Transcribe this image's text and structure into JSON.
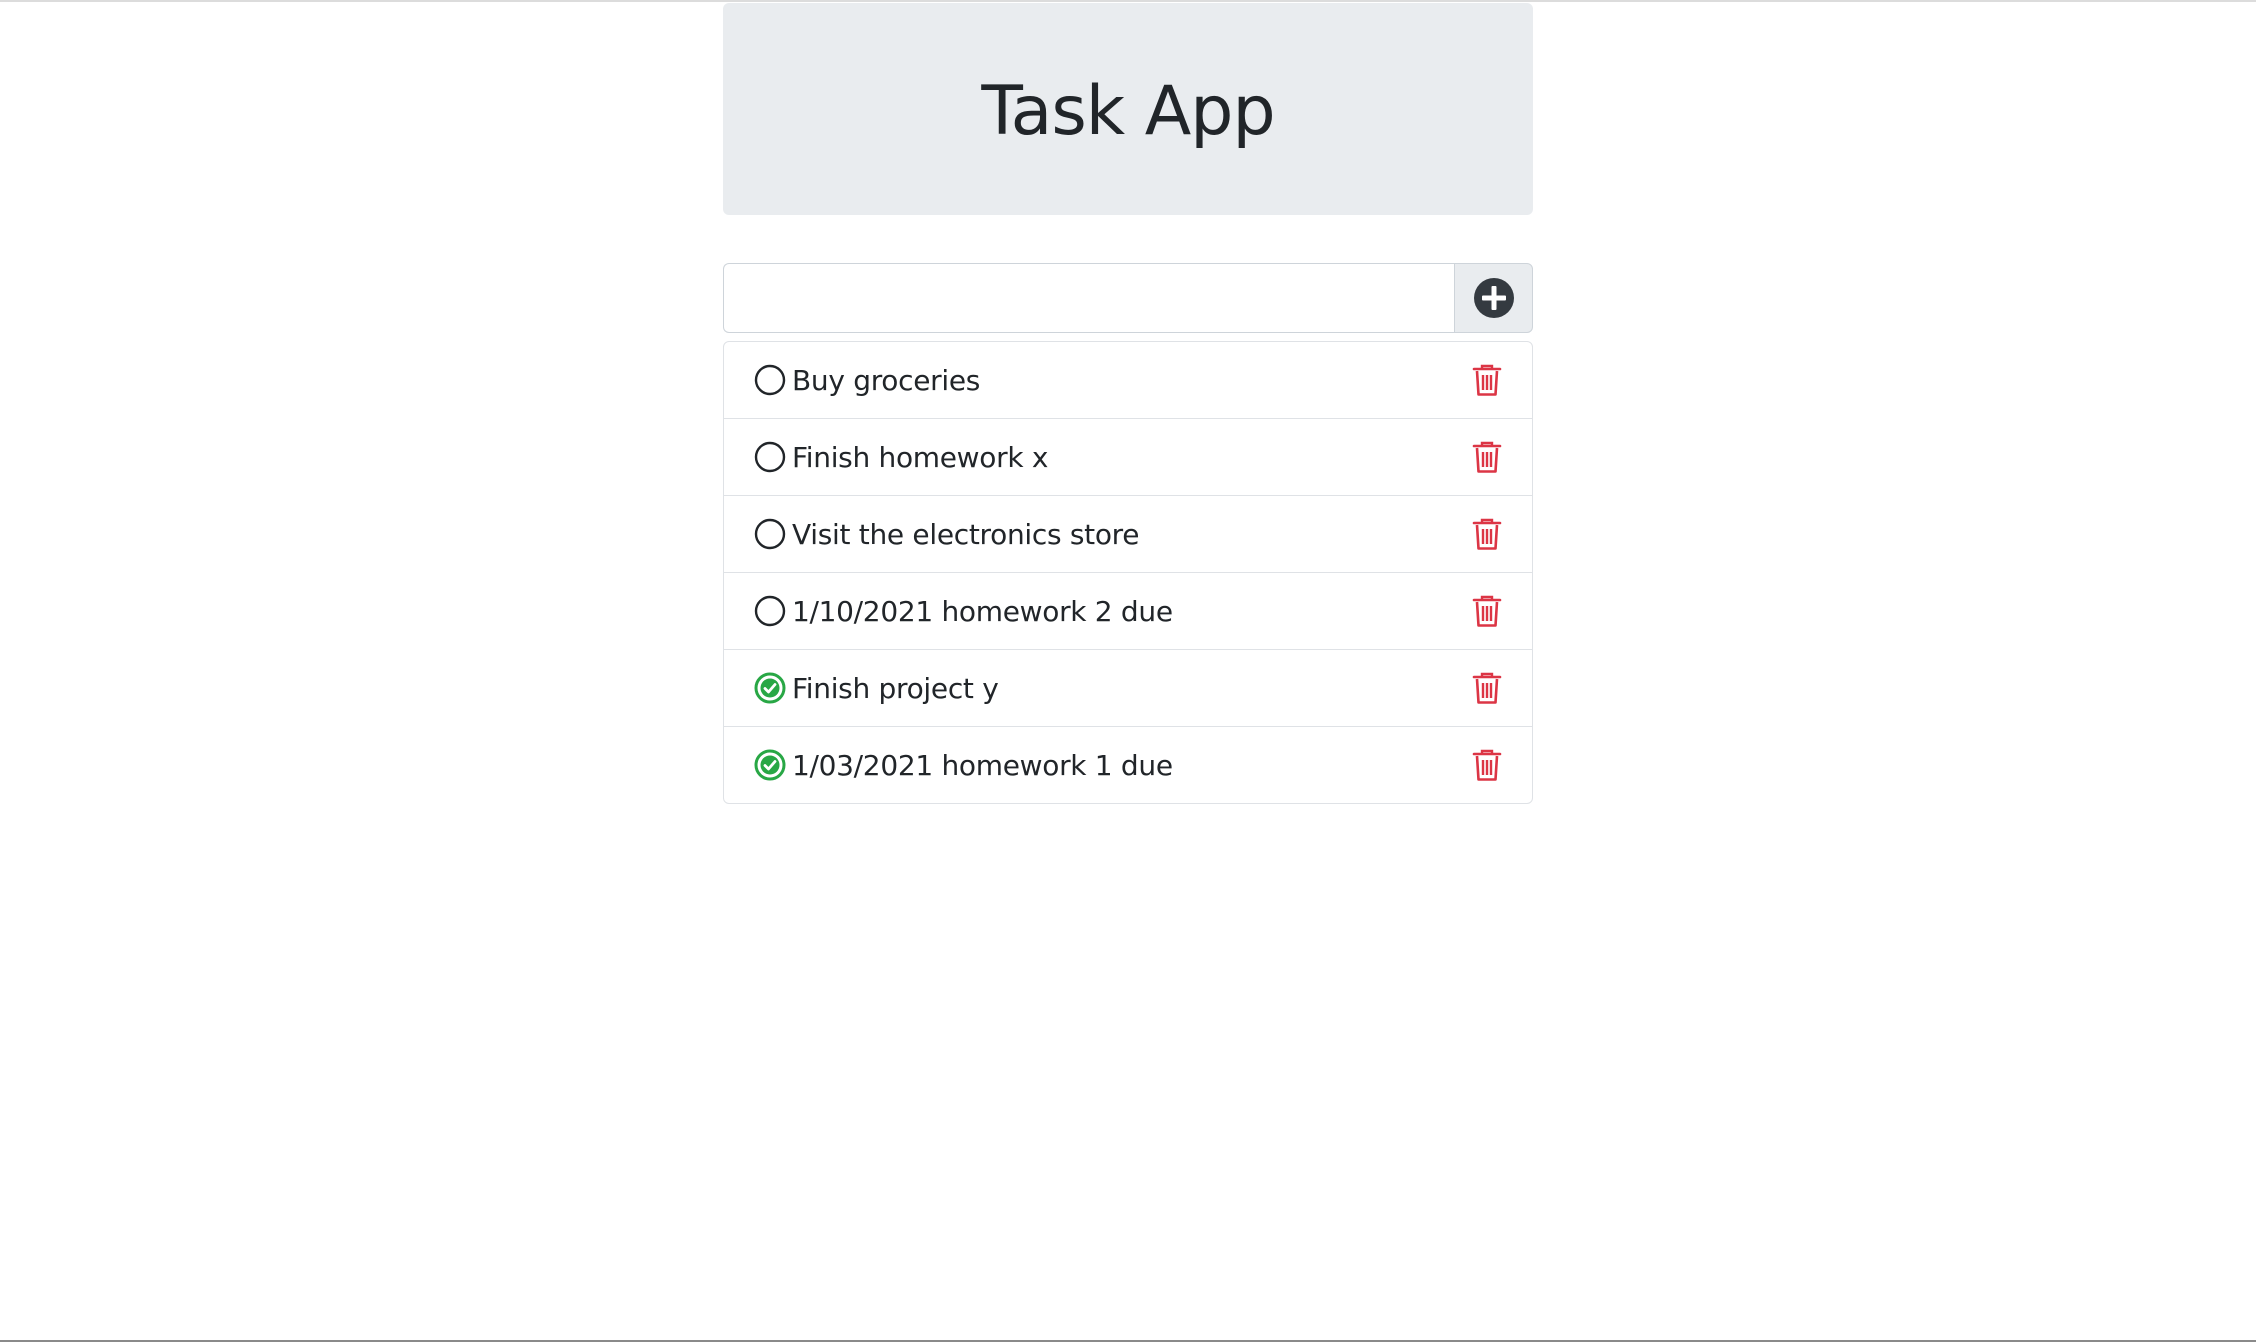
{
  "header": {
    "title": "Task App"
  },
  "new_task": {
    "value": "",
    "placeholder": "",
    "add_icon": "plus-circle-icon"
  },
  "tasks": [
    {
      "text": "Buy groceries",
      "done": false,
      "status_icon": "circle-outline-icon",
      "delete_icon": "trash-icon"
    },
    {
      "text": "Finish homework x",
      "done": false,
      "status_icon": "circle-outline-icon",
      "delete_icon": "trash-icon"
    },
    {
      "text": "Visit the electronics store",
      "done": false,
      "status_icon": "circle-outline-icon",
      "delete_icon": "trash-icon"
    },
    {
      "text": "1/10/2021 homework 2 due",
      "done": false,
      "status_icon": "circle-outline-icon",
      "delete_icon": "trash-icon"
    },
    {
      "text": "Finish project y",
      "done": true,
      "status_icon": "check-circle-icon",
      "delete_icon": "trash-icon"
    },
    {
      "text": "1/03/2021 homework 1 due",
      "done": true,
      "status_icon": "check-circle-icon",
      "delete_icon": "trash-icon"
    }
  ],
  "colors": {
    "header_bg": "#e9ecef",
    "done_green": "#28a745",
    "delete_red": "#dc3545",
    "add_icon": "#343a40"
  }
}
